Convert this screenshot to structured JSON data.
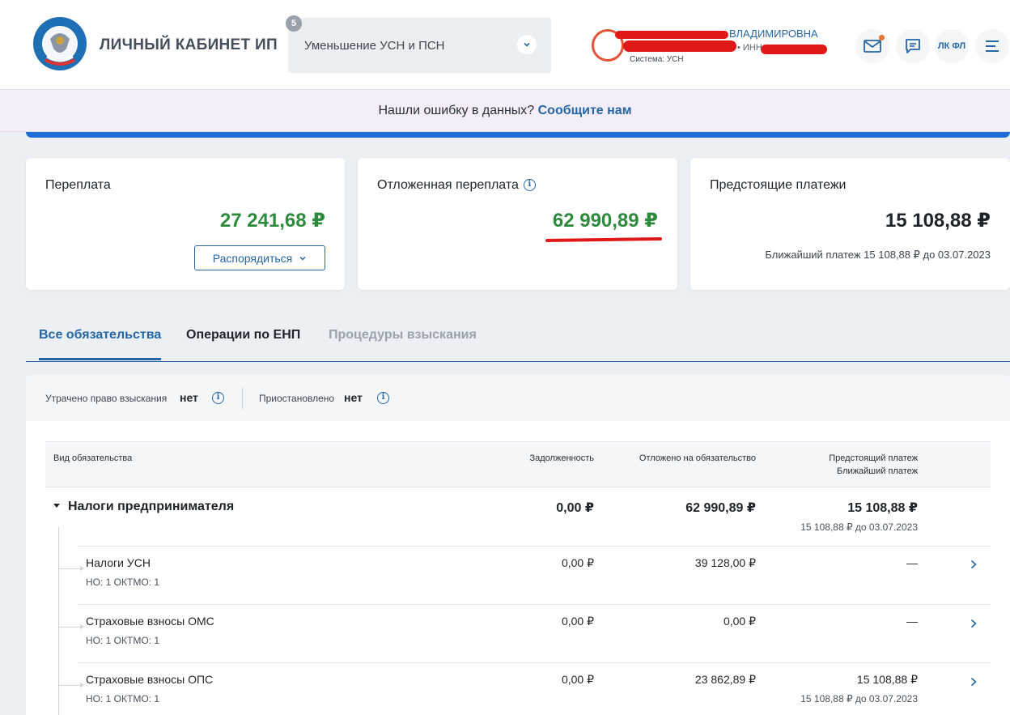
{
  "header": {
    "brand": "ЛИЧНЫЙ КАБИНЕТ ИП",
    "mode_badge": "5",
    "mode_select": "Уменьшение УСН и ПСН",
    "user_name": "ВЛАДИМИРОВНА",
    "user_inn": "• ИНН",
    "user_system": "Система: УСН",
    "lk_fl": "ЛК ФЛ"
  },
  "banner": {
    "text": "Нашли ошибку в данных?",
    "link": "Сообщите нам"
  },
  "cards": {
    "overpay_title": "Переплата",
    "overpay_amount": "27 241,68 ₽",
    "dispose_button": "Распорядиться",
    "deferred_title": "Отложенная переплата",
    "deferred_amount": "62 990,89 ₽",
    "upcoming_title": "Предстоящие платежи",
    "upcoming_amount": "15 108,88 ₽",
    "nearest_payment": "Ближайший платеж 15 108,88 ₽ до 03.07.2023"
  },
  "tabs": [
    "Все обязательства",
    "Операции по ЕНП",
    "Процедуры взыскания"
  ],
  "filters": {
    "lost_label": "Утрачено право взыскания",
    "lost_value": "нет",
    "suspended_label": "Приостановлено",
    "suspended_value": "нет"
  },
  "table": {
    "headers": {
      "type": "Вид обязательства",
      "debt": "Задолженность",
      "deferred": "Отложено на обязательство",
      "upcoming": "Предстоящий платеж",
      "nearest": "Ближайший платеж"
    },
    "group": {
      "name": "Налоги предпринимателя",
      "debt": "0,00 ₽",
      "deferred": "62 990,89 ₽",
      "upcoming": "15 108,88 ₽",
      "upcoming_sub": "15 108,88 ₽ до 03.07.2023"
    },
    "rows": [
      {
        "name": "Налоги УСН",
        "meta": "НО: 1 ОКТМО: 1",
        "debt": "0,00 ₽",
        "deferred": "39 128,00 ₽",
        "upcoming": "—",
        "upcoming_sub": ""
      },
      {
        "name": "Страховые взносы ОМС",
        "meta": "НО: 1 ОКТМО: 1",
        "debt": "0,00 ₽",
        "deferred": "0,00 ₽",
        "upcoming": "—",
        "upcoming_sub": ""
      },
      {
        "name": "Страховые взносы ОПС",
        "meta": "НО: 1 ОКТМО: 1",
        "debt": "0,00 ₽",
        "deferred": "23 862,89 ₽",
        "upcoming": "15 108,88 ₽",
        "upcoming_sub": "15 108,88 ₽ до 03.07.2023"
      }
    ]
  }
}
